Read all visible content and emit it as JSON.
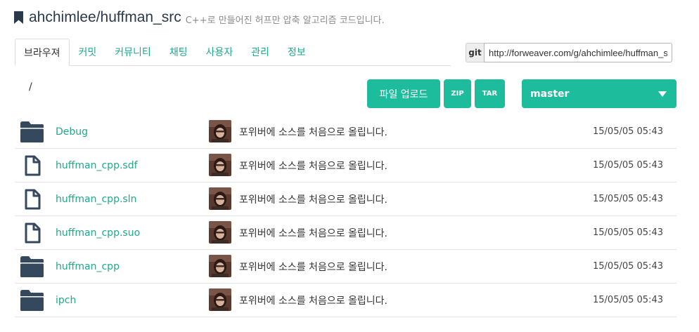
{
  "repo": {
    "name": "ahchimlee/huffman_src",
    "description": "C++로 만들어진 허프만 압축 알고리즘 코드입니다."
  },
  "tabs": [
    {
      "label": "브라우져"
    },
    {
      "label": "커밋"
    },
    {
      "label": "커뮤니티"
    },
    {
      "label": "채팅"
    },
    {
      "label": "사용자"
    },
    {
      "label": "관리"
    },
    {
      "label": "정보"
    }
  ],
  "clone": {
    "protocol": "git",
    "url": "http://forweaver.com/g/ahchimlee/huffman_src.git"
  },
  "path": "/",
  "actions": {
    "upload": "파일 업로드",
    "zip": "ZIP",
    "tar": "TAR",
    "branch": "master"
  },
  "files": [
    {
      "name": "Debug",
      "type": "folder",
      "message": "포위버에 소스를 처음으로 올립니다.",
      "date": "15/05/05 05:43"
    },
    {
      "name": "huffman_cpp.sdf",
      "type": "file",
      "message": "포위버에 소스를 처음으로 올립니다.",
      "date": "15/05/05 05:43"
    },
    {
      "name": "huffman_cpp.sln",
      "type": "file",
      "message": "포위버에 소스를 처음으로 올립니다.",
      "date": "15/05/05 05:43"
    },
    {
      "name": "huffman_cpp.suo",
      "type": "file",
      "message": "포위버에 소스를 처음으로 올립니다.",
      "date": "15/05/05 05:43"
    },
    {
      "name": "huffman_cpp",
      "type": "folder",
      "message": "포위버에 소스를 처음으로 올립니다.",
      "date": "15/05/05 05:43"
    },
    {
      "name": "ipch",
      "type": "folder",
      "message": "포위버에 소스를 처음으로 올립니다.",
      "date": "15/05/05 05:43"
    }
  ],
  "colors": {
    "accent": "#1dbc9c",
    "link": "#1fa88a",
    "icon": "#34495e"
  }
}
